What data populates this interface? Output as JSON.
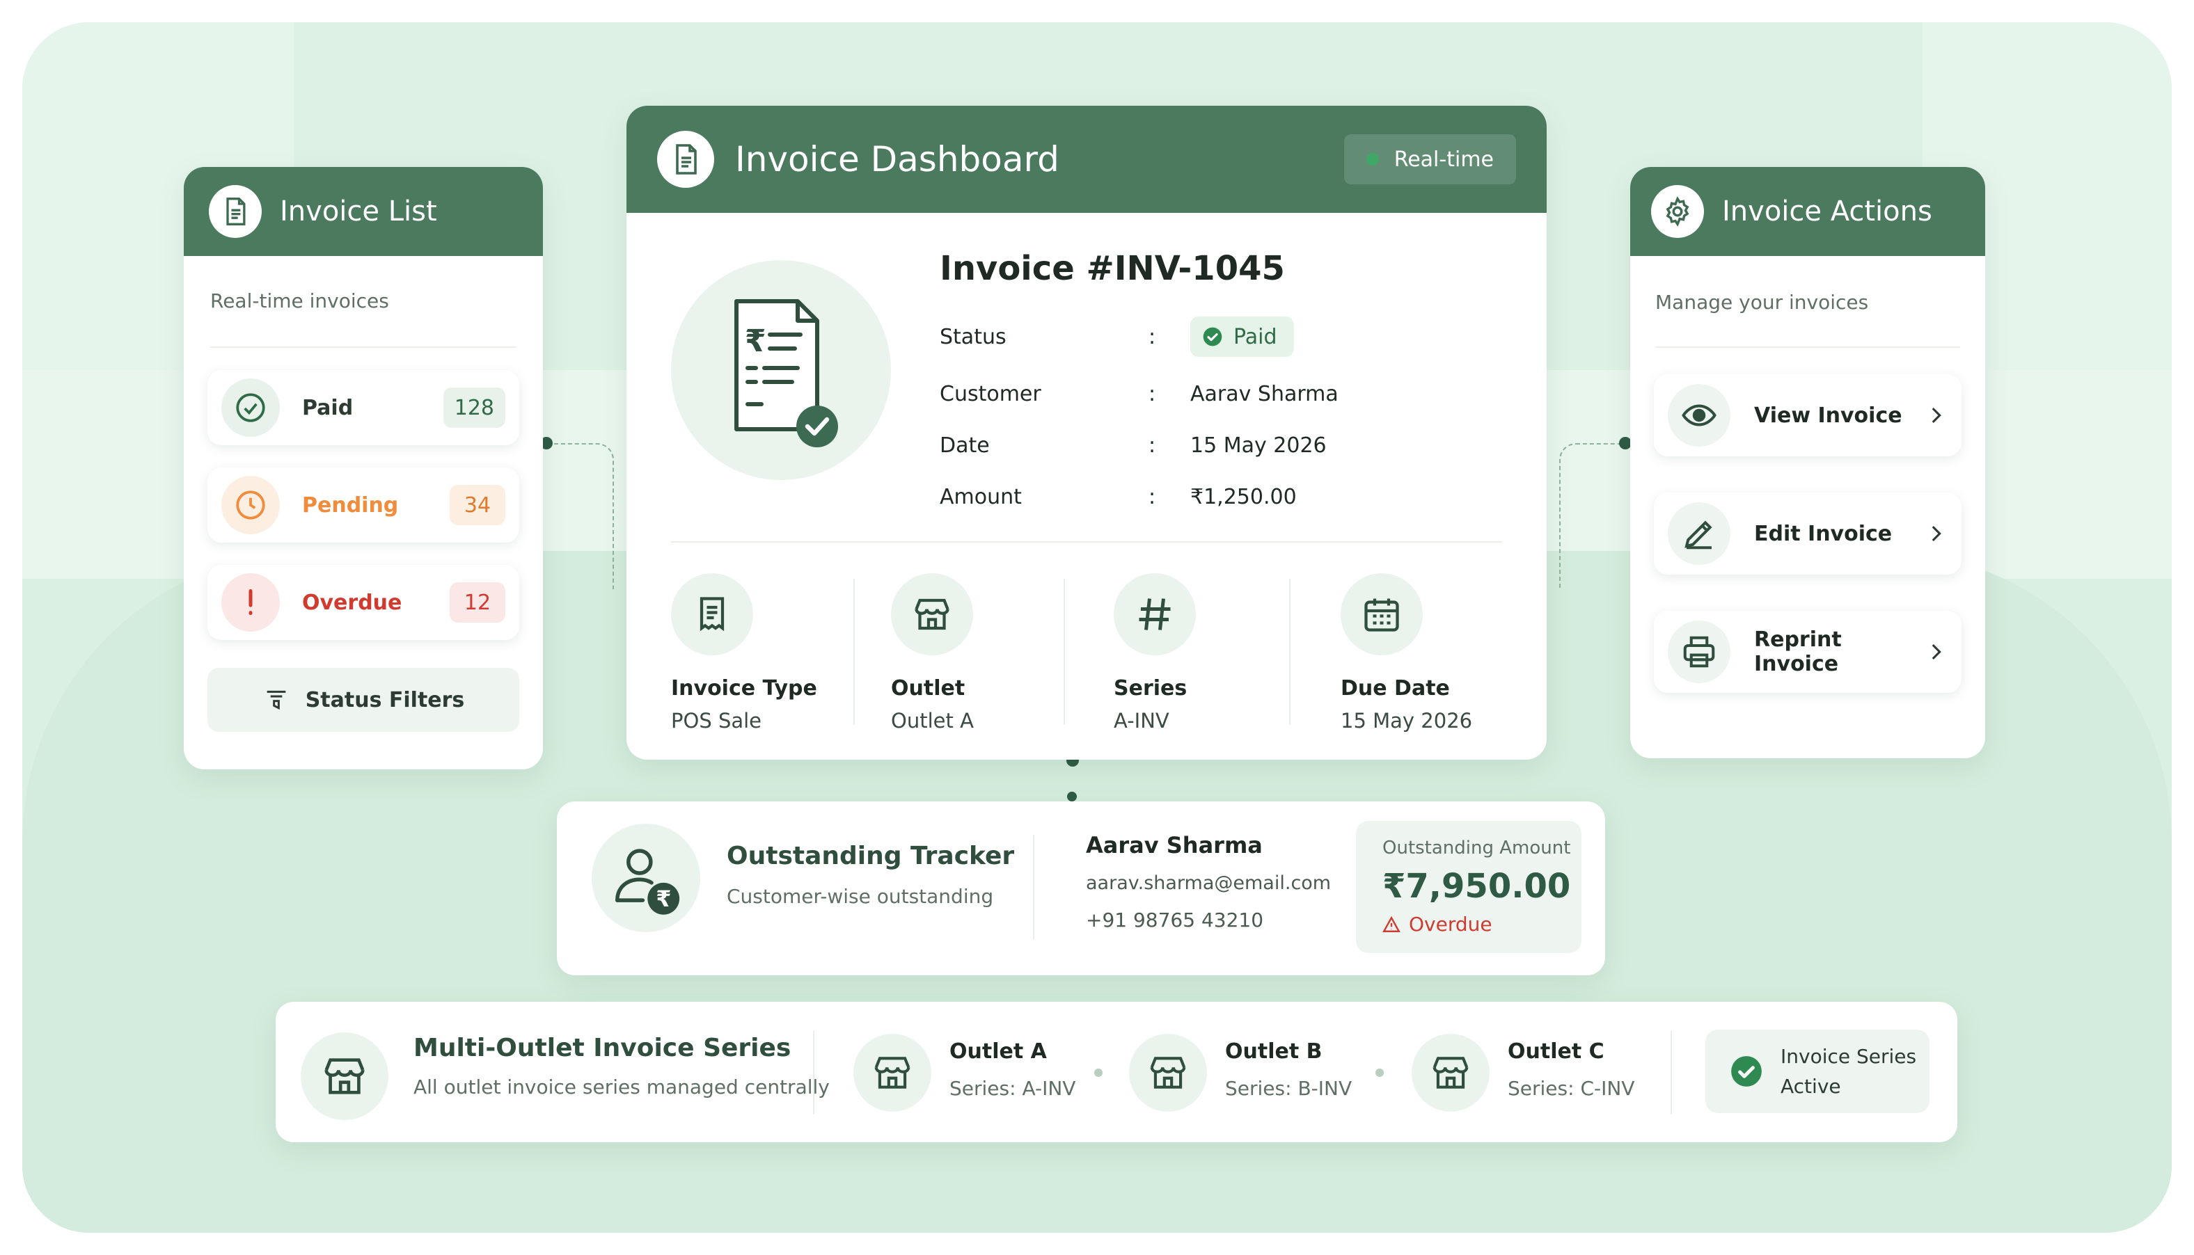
{
  "colors": {
    "primary": "#4b7a5f",
    "paid": "#2f6b46",
    "pending": "#f08c3c",
    "overdue": "#d03a2f",
    "background": "#daf0e2"
  },
  "invoice_list": {
    "title": "Invoice List",
    "subtitle": "Real-time invoices",
    "statuses": [
      {
        "label": "Paid",
        "count": "128",
        "icon": "check-circle-icon"
      },
      {
        "label": "Pending",
        "count": "34",
        "icon": "clock-icon"
      },
      {
        "label": "Overdue",
        "count": "12",
        "icon": "exclamation-icon"
      }
    ],
    "filters_label": "Status Filters"
  },
  "dashboard": {
    "title": "Invoice Dashboard",
    "realtime_label": "Real-time",
    "invoice_number": "Invoice #INV-1045",
    "fields": [
      {
        "key": "Status",
        "value": "Paid"
      },
      {
        "key": "Customer",
        "value": "Aarav Sharma"
      },
      {
        "key": "Date",
        "value": "15 May 2026"
      },
      {
        "key": "Amount",
        "value": "₹1,250.00"
      }
    ],
    "separator": ":",
    "meta": [
      {
        "label": "Invoice Type",
        "value": "POS Sale",
        "icon": "receipt-icon"
      },
      {
        "label": "Outlet",
        "value": "Outlet A",
        "icon": "store-icon"
      },
      {
        "label": "Series",
        "value": "A-INV",
        "icon": "hash-icon"
      },
      {
        "label": "Due Date",
        "value": "15 May 2026",
        "icon": "calendar-icon"
      }
    ]
  },
  "actions": {
    "title": "Invoice Actions",
    "subtitle": "Manage your invoices",
    "items": [
      {
        "label": "View Invoice",
        "icon": "eye-icon"
      },
      {
        "label": "Edit Invoice",
        "icon": "pencil-icon"
      },
      {
        "label": "Reprint Invoice",
        "icon": "printer-icon"
      }
    ]
  },
  "tracker": {
    "title": "Outstanding Tracker",
    "subtitle": "Customer-wise outstanding",
    "customer_name": "Aarav Sharma",
    "email": "aarav.sharma@email.com",
    "phone": "+91 98765 43210",
    "amount_label": "Outstanding Amount",
    "amount": "₹7,950.00",
    "amount_status": "Overdue"
  },
  "series": {
    "title": "Multi-Outlet Invoice Series",
    "subtitle": "All outlet invoice series managed centrally",
    "outlets": [
      {
        "name": "Outlet A",
        "series": "Series: A-INV"
      },
      {
        "name": "Outlet B",
        "series": "Series: B-INV"
      },
      {
        "name": "Outlet C",
        "series": "Series: C-INV"
      }
    ],
    "active_line1": "Invoice Series",
    "active_line2": "Active"
  }
}
